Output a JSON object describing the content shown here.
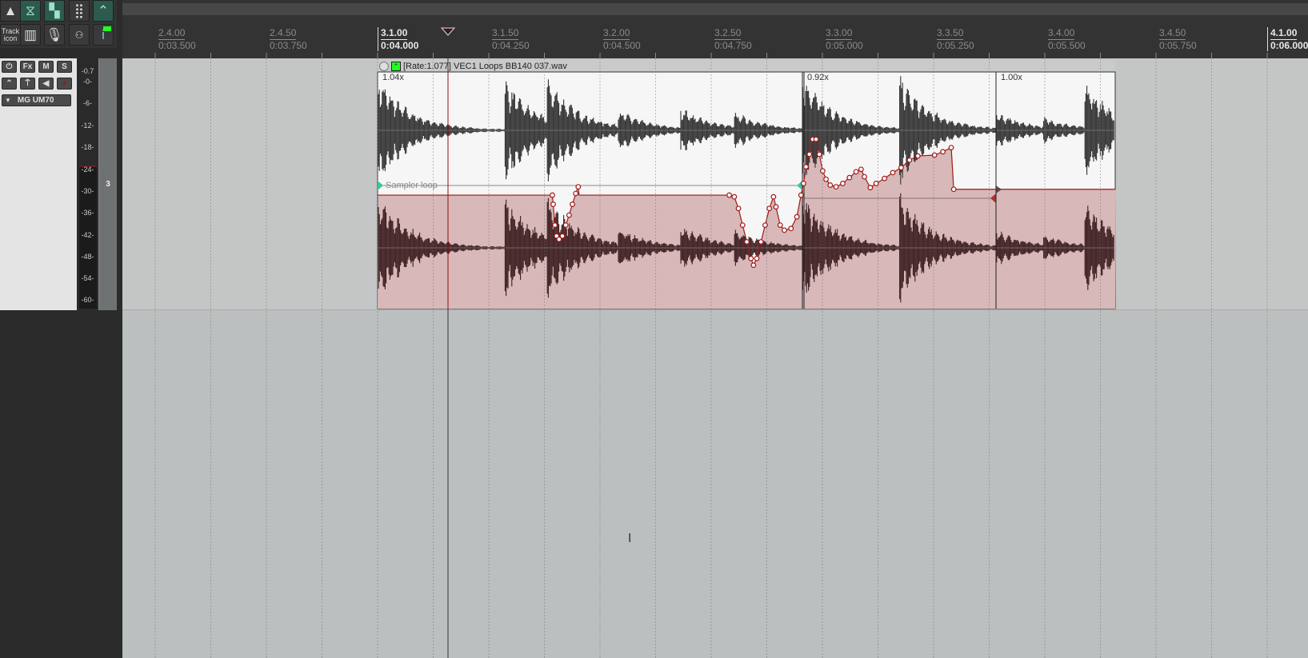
{
  "toolbar": {
    "icons": [
      "metronome-icon",
      "snap-icon",
      "grid-icon",
      "ripple-grid-icon",
      "envelope-lock-icon",
      "track-icon",
      "midi-keyboard-icon",
      "microphone-icon",
      "tape-icon",
      "info-icon"
    ],
    "track_icon_label_1": "Track",
    "track_icon_label_2": "icon"
  },
  "track": {
    "number": "3",
    "name": "MG UM70",
    "buttons": {
      "fx": "Fx",
      "mute": "M",
      "solo": "S"
    },
    "meter_labels": [
      "-0.7",
      "-0-",
      "-6-",
      "-12-",
      "-18-",
      "-24-",
      "-30-",
      "-36-",
      "-42-",
      "-48-",
      "-54-",
      "-60-"
    ]
  },
  "ruler": {
    "marks": [
      {
        "beat": "2.4.00",
        "time": "0:03.500",
        "bar": false
      },
      {
        "beat": "2.4.50",
        "time": "0:03.750",
        "bar": false
      },
      {
        "beat": "3.1.00",
        "time": "0:04.000",
        "bar": true
      },
      {
        "beat": "3.1.50",
        "time": "0:04.250",
        "bar": false
      },
      {
        "beat": "3.2.00",
        "time": "0:04.500",
        "bar": false
      },
      {
        "beat": "3.2.50",
        "time": "0:04.750",
        "bar": false
      },
      {
        "beat": "3.3.00",
        "time": "0:05.000",
        "bar": false
      },
      {
        "beat": "3.3.50",
        "time": "0:05.250",
        "bar": false
      },
      {
        "beat": "3.4.00",
        "time": "0:05.500",
        "bar": false
      },
      {
        "beat": "3.4.50",
        "time": "0:05.750",
        "bar": false
      },
      {
        "beat": "4.1.00",
        "time": "0:06.000",
        "bar": true
      }
    ]
  },
  "item": {
    "title": "[Rate:1.077] VEC1 Loops BB140 037.wav",
    "stretch_markers": [
      "1.04x",
      "0.92x",
      "1.00x"
    ],
    "take_envelope_label": "Sampler loop",
    "colors": {
      "envelope": "#a01818",
      "fill": "#d8b8b9",
      "waveform_top": "#333333",
      "waveform_bottom": "#3e2022",
      "item_bg": "#f6f6f6"
    }
  },
  "colors": {
    "ruler_bg": "#333333",
    "track_bg": "#c4c6c5",
    "empty_bg": "#bcbfbf"
  }
}
